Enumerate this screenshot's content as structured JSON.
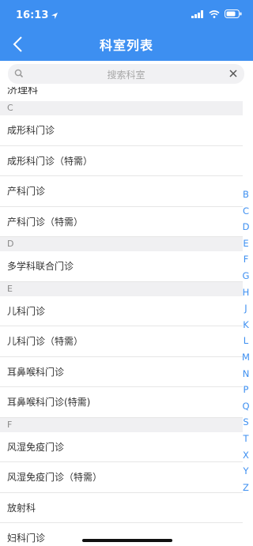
{
  "status_bar": {
    "time": "16:13"
  },
  "header": {
    "title": "科室列表"
  },
  "search": {
    "placeholder": "搜索科室"
  },
  "list": {
    "cutoff_item": "济理科",
    "sections": [
      {
        "letter": "C",
        "items": [
          "成形科门诊",
          "成形科门诊（特需）",
          "产科门诊",
          "产科门诊（特需）"
        ]
      },
      {
        "letter": "D",
        "items": [
          "多学科联合门诊"
        ]
      },
      {
        "letter": "E",
        "items": [
          "儿科门诊",
          "儿科门诊（特需）",
          "耳鼻喉科门诊",
          "耳鼻喉科门诊(特需)"
        ]
      },
      {
        "letter": "F",
        "items": [
          "风湿免疫门诊",
          "风湿免疫门诊（特需）",
          "放射科",
          "妇科门诊"
        ]
      }
    ]
  },
  "index_letters": [
    "B",
    "C",
    "D",
    "E",
    "F",
    "G",
    "H",
    "J",
    "K",
    "L",
    "M",
    "N",
    "P",
    "Q",
    "S",
    "T",
    "X",
    "Y",
    "Z"
  ],
  "colors": {
    "accent": "#3d8ff1",
    "section_bg": "#f0f0f2"
  }
}
